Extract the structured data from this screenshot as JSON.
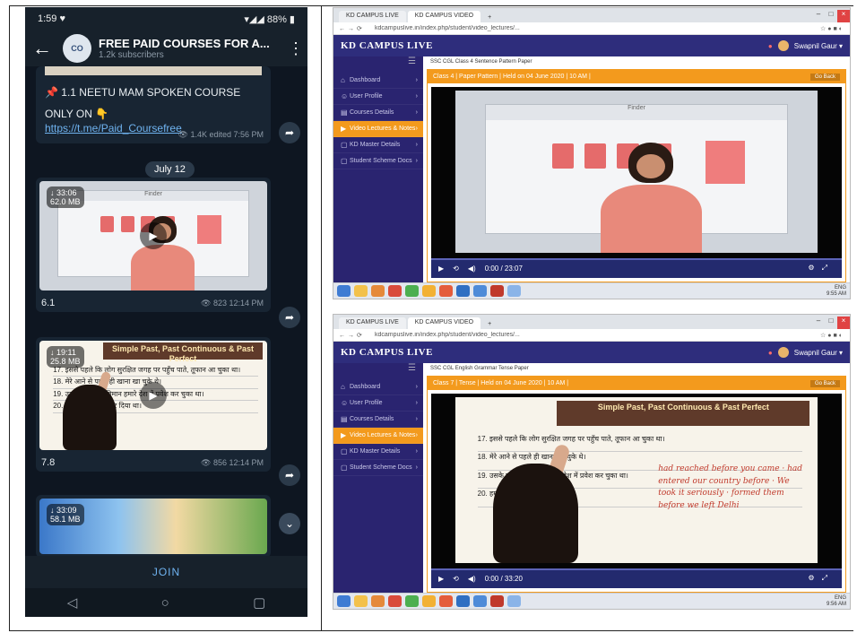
{
  "phone": {
    "status": {
      "time": "1:59 ♥",
      "battery": "88% ▮",
      "signal": "▾◢◢"
    },
    "header": {
      "title": "FREE PAID COURSES FOR A...",
      "subtitle": "1.2k subscribers",
      "avatar_text": "CO"
    },
    "messages": [
      {
        "title": "📌 1.1 NEETU MAM SPOKEN COURSE",
        "body": "ONLY ON 👇",
        "link": "https://t.me/Paid_Coursefree",
        "meta": "👁 1.4K  edited 7:56 PM"
      }
    ],
    "date_chip": "July 12",
    "videos": [
      {
        "duration": "33:06",
        "size": "62.0 MB",
        "caption": "6.1",
        "meta": "👁 823  12:14 PM"
      },
      {
        "duration": "19:11",
        "size": "25.8 MB",
        "caption": "7.8",
        "meta": "👁 856  12:14 PM"
      },
      {
        "duration": "33:09",
        "size": "58.1 MB"
      }
    ],
    "join_label": "JOIN",
    "nav": {
      "back": "◁",
      "home": "○",
      "recent": "▢"
    },
    "share_glyph": "➦",
    "down_glyph": "⌄"
  },
  "browsers": [
    {
      "tabs": [
        "KD CAMPUS LIVE",
        "KD CAMPUS VIDEO"
      ],
      "url": "kdcampuslive.in/index.php/student/video_lectures/...",
      "brand": "KD CAMPUS LIVE",
      "user": "Swapnil Gaur ▾",
      "sidebar": [
        {
          "label": "Dashboard",
          "active": false
        },
        {
          "label": "User Profile",
          "active": false
        },
        {
          "label": "Courses Details",
          "active": false
        },
        {
          "label": "Video Lectures & Notes",
          "active": true
        },
        {
          "label": "KD Master Details",
          "active": false
        },
        {
          "label": "Student Scheme Docs",
          "active": false
        }
      ],
      "breadcrumb": "SSC CGL  Class 4 Sentence Pattern  Paper",
      "video_title": "Class 4 | Paper Pattern | Held on 04 June 2020 | 10 AM |",
      "back_label": "Go Back",
      "time": "0:00 / 23:07",
      "scene": "finder",
      "finder_label": "Finder",
      "tray": "ENG\n9:55 AM"
    },
    {
      "tabs": [
        "KD CAMPUS LIVE",
        "KD CAMPUS VIDEO"
      ],
      "url": "kdcampuslive.in/index.php/student/video_lectures/...",
      "brand": "KD CAMPUS LIVE",
      "user": "Swapnil Gaur ▾",
      "sidebar": [
        {
          "label": "Dashboard",
          "active": false
        },
        {
          "label": "User Profile",
          "active": false
        },
        {
          "label": "Courses Details",
          "active": false
        },
        {
          "label": "Video Lectures & Notes",
          "active": true
        },
        {
          "label": "KD Master Details",
          "active": false
        },
        {
          "label": "Student Scheme Docs",
          "active": false
        }
      ],
      "breadcrumb": "SSC CGL  English Grammar Tense  Paper",
      "video_title": "Class 7 | Tense | Held on 04 June 2020 | 10 AM |",
      "back_label": "Go Back",
      "time": "0:00 / 33:20",
      "scene": "board",
      "board_title": "Simple Past, Past Continuous & Past Perfect",
      "board_lines": [
        "17. इससे पहले कि लोग सुरक्षित जगह पर पहुँच पाते, तूफान आ चुका था।",
        "18. मेरे आने से पहले ही खाना खा चुके थे।",
        "19. उसके पहले ही, विमान हमारे देश में प्रवेश कर चुका था।",
        "20. हमने उन्हें सूचित कर दिया था।"
      ],
      "board_red": "had reached before you came · had entered our country before · We took it seriously · formed them before we left Delhi",
      "tray": "ENG\n9:56 AM"
    }
  ],
  "colors": {
    "telegram_bg": "#0e1621",
    "kd_nav": "#2e2d7c",
    "accent": "#f39a1d"
  }
}
